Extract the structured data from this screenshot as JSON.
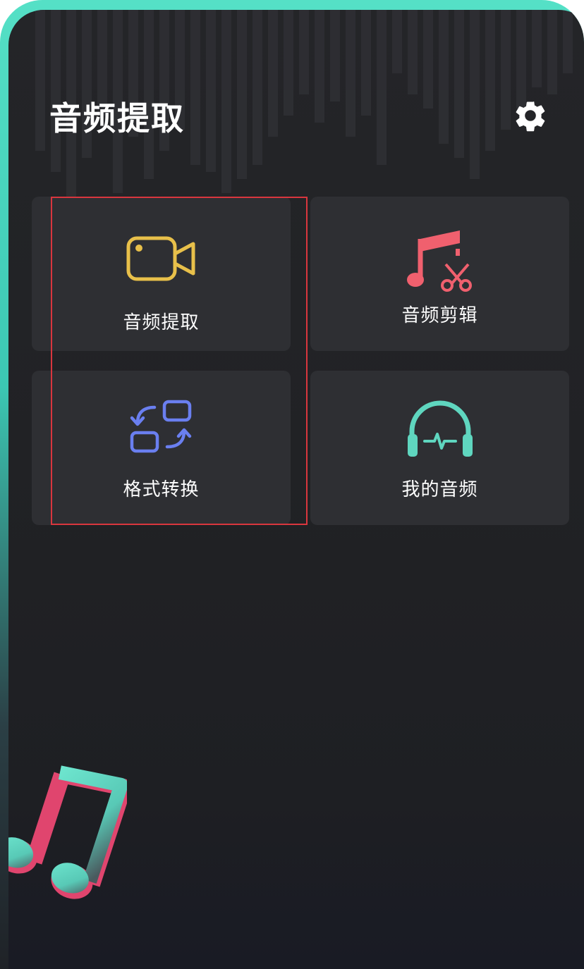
{
  "app": {
    "title": "音频提取"
  },
  "header": {
    "settings_icon": "gear-icon"
  },
  "menu": {
    "items": [
      {
        "label": "音频提取",
        "icon": "video-camera-icon",
        "color": "#e8c04a"
      },
      {
        "label": "音频剪辑",
        "icon": "music-scissors-icon",
        "color": "#f0606e"
      },
      {
        "label": "格式转换",
        "icon": "format-convert-icon",
        "color": "#6a7ff0"
      },
      {
        "label": "我的音频",
        "icon": "headphones-icon",
        "color": "#5fd6bf"
      }
    ]
  },
  "colors": {
    "accent_teal": "#55e0c6",
    "background": "#222327",
    "card": "#2e2f33",
    "selection_box": "#d9363e"
  },
  "decoration": {
    "music_note_icon": "music-note-icon"
  }
}
